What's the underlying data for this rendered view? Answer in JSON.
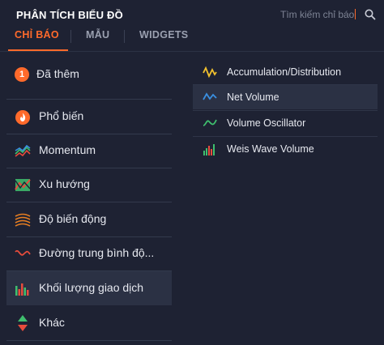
{
  "header": {
    "title": "PHÂN TÍCH BIỂU ĐỒ",
    "search": {
      "placeholder": "Tìm kiếm chỉ báo"
    }
  },
  "tabs": [
    {
      "label": "CHỈ BÁO",
      "active": true
    },
    {
      "label": "MẪU",
      "active": false
    },
    {
      "label": "WIDGETS",
      "active": false
    }
  ],
  "categories": {
    "added": {
      "count": "1",
      "label": "Đã thêm"
    },
    "items": [
      {
        "label": "Phổ biến",
        "icon": "fire-icon"
      },
      {
        "label": "Momentum",
        "icon": "momentum-icon"
      },
      {
        "label": "Xu hướng",
        "icon": "trend-icon"
      },
      {
        "label": "Độ biến động",
        "icon": "volatility-icon"
      },
      {
        "label": "Đường trung bình độ...",
        "icon": "moving-average-icon"
      },
      {
        "label": "Khối lượng giao dịch",
        "icon": "volume-bars-icon",
        "selected": true
      },
      {
        "label": "Khác",
        "icon": "other-arrows-icon"
      }
    ]
  },
  "indicators": [
    {
      "label": "Accumulation/Distribution",
      "icon": "accumulation-distribution-icon",
      "color": "#f2c12e"
    },
    {
      "label": "Net Volume",
      "icon": "net-volume-icon",
      "color": "#3a8fe0",
      "hovered": true
    },
    {
      "label": "Volume Oscillator",
      "icon": "volume-oscillator-icon",
      "color": "#3fbf6e"
    },
    {
      "label": "Weis Wave Volume",
      "icon": "weis-wave-volume-icon",
      "color": "#e74c3c"
    }
  ],
  "colors": {
    "accent": "#ff6a2b",
    "background": "#1e2233",
    "selected": "#2b3144"
  }
}
